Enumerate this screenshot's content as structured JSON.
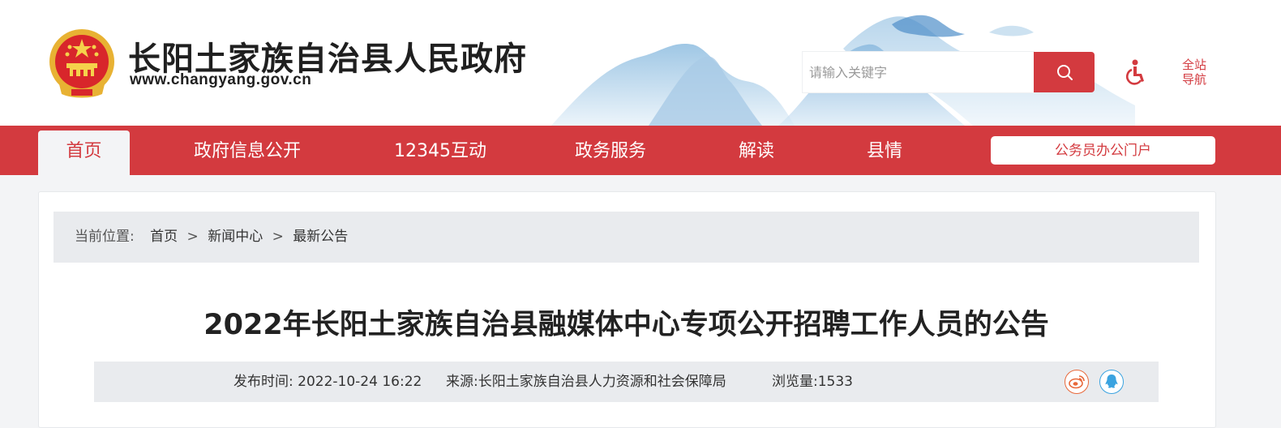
{
  "header": {
    "site_title": "长阳土家族自治县人民政府",
    "site_url": "www.changyang.gov.cn",
    "search_placeholder": "请输入关键字",
    "site_nav_line1": "全站",
    "site_nav_line2": "导航",
    "icons": [
      "national-emblem-icon",
      "search-icon",
      "accessibility-icon"
    ]
  },
  "nav": {
    "items": [
      "首页",
      "政府信息公开",
      "12345互动",
      "政务服务",
      "解读",
      "县情"
    ],
    "active_index": 0,
    "portal_button": "公务员办公门户"
  },
  "breadcrumb": {
    "label": "当前位置:",
    "items": [
      "首页",
      "新闻中心",
      "最新公告"
    ],
    "separator": ">"
  },
  "article": {
    "title": "2022年长阳土家族自治县融媒体中心专项公开招聘工作人员的公告",
    "publish_time": "发布时间: 2022-10-24 16:22",
    "source": "来源:长阳土家族自治县人力资源和社会保障局",
    "views": "浏览量:1533",
    "share_icons": [
      "weibo-icon",
      "qq-icon"
    ]
  },
  "colors": {
    "brand_red": "#d33a3f",
    "page_bg": "#f3f4f6",
    "panel_gray": "#e9ebee"
  }
}
